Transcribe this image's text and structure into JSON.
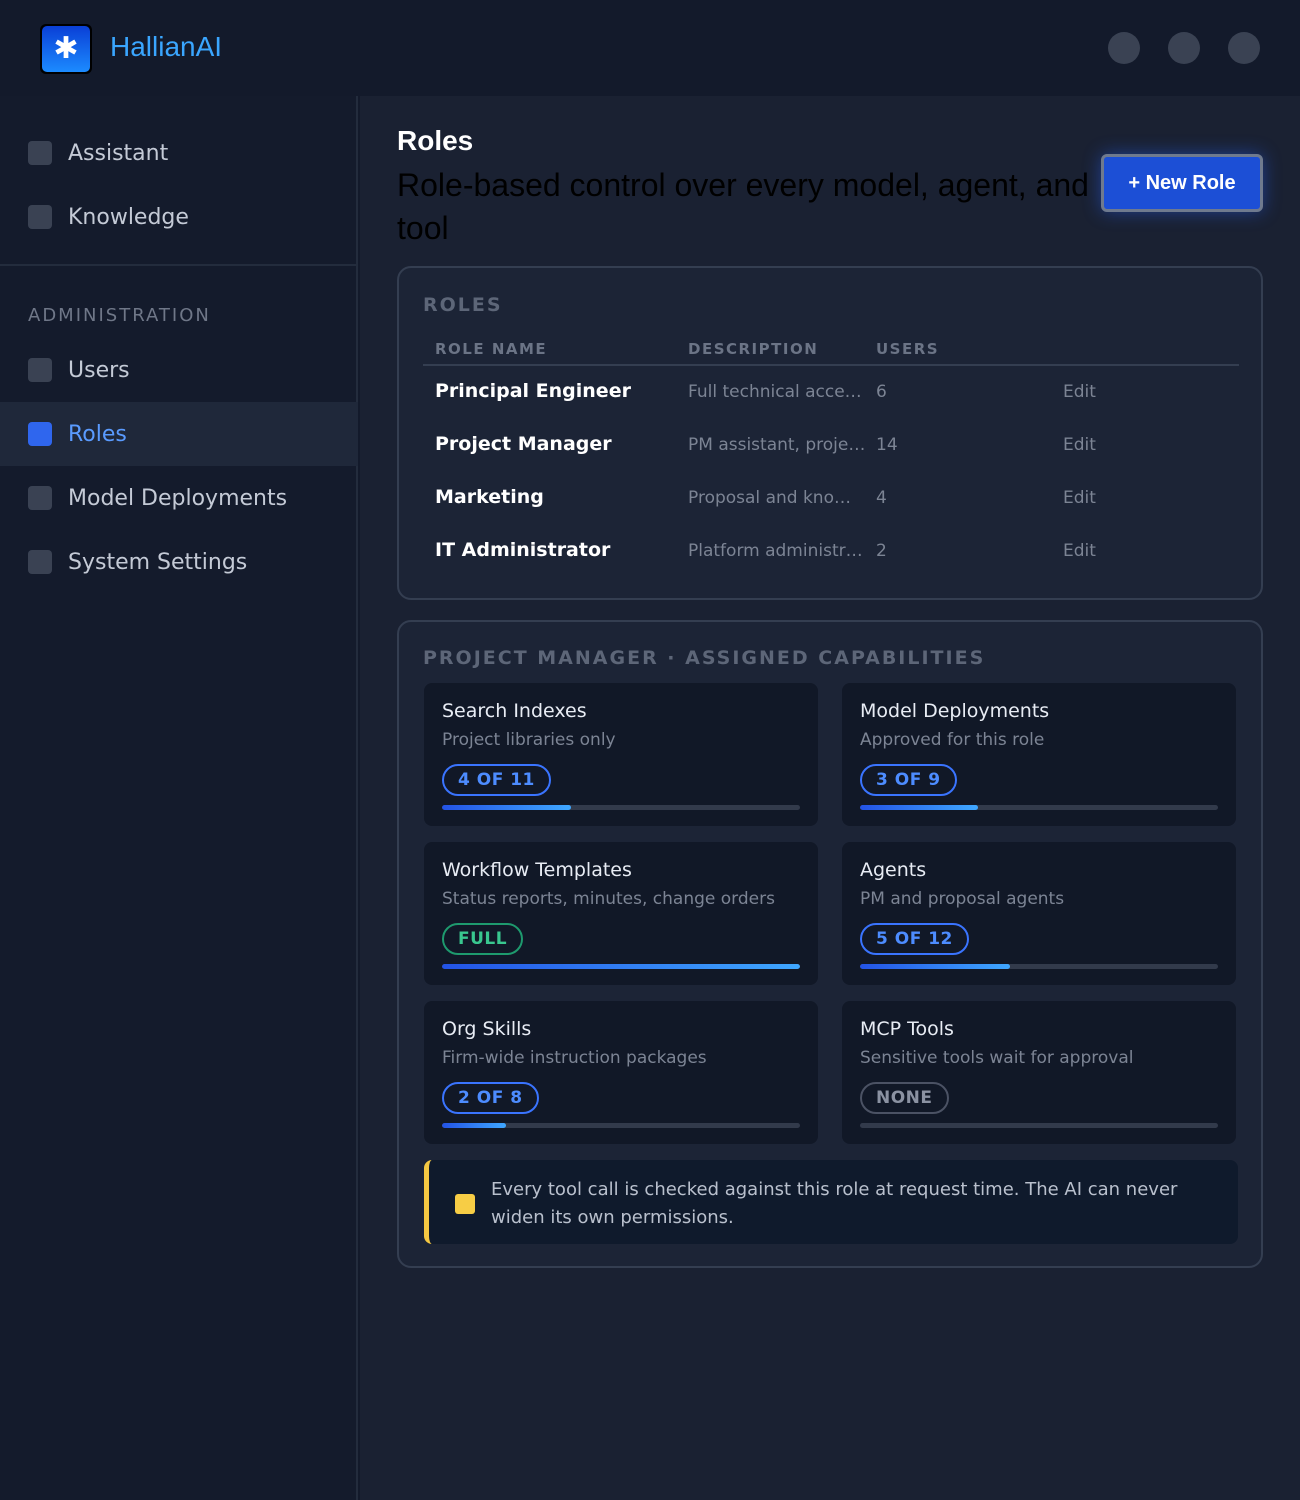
{
  "app": {
    "name": "HallianAI",
    "logo_glyph": "✱"
  },
  "sidebar": {
    "items": [
      {
        "label": "Assistant"
      },
      {
        "label": "Knowledge"
      }
    ],
    "admin_label": "ADMINISTRATION",
    "admin_items": [
      {
        "label": "Users",
        "active": false
      },
      {
        "label": "Roles",
        "active": true
      },
      {
        "label": "Model Deployments",
        "active": false
      },
      {
        "label": "System Settings",
        "active": false
      }
    ]
  },
  "page": {
    "title": "Roles",
    "subtitle": "Role-based control over every model, agent, and tool",
    "new_button": "+ New Role"
  },
  "roles_table": {
    "title": "ROLES",
    "headers": [
      "ROLE NAME",
      "DESCRIPTION",
      "USERS"
    ],
    "rows": [
      {
        "name": "Principal Engineer",
        "description": "Full technical acce…",
        "users": "6",
        "action": "Edit"
      },
      {
        "name": "Project Manager",
        "description": "PM assistant, proje…",
        "users": "14",
        "action": "Edit"
      },
      {
        "name": "Marketing",
        "description": "Proposal and kno…",
        "users": "4",
        "action": "Edit"
      },
      {
        "name": "IT Administrator",
        "description": "Platform administr…",
        "users": "2",
        "action": "Edit"
      }
    ]
  },
  "capabilities": {
    "title": "PROJECT MANAGER · ASSIGNED CAPABILITIES",
    "cards": [
      {
        "title": "Search Indexes",
        "subtitle": "Project libraries only",
        "badge": "4 OF 11",
        "kind": "partial",
        "fill": 0.36
      },
      {
        "title": "Model Deployments",
        "subtitle": "Approved for this role",
        "badge": "3 OF 9",
        "kind": "partial",
        "fill": 0.33
      },
      {
        "title": "Workflow Templates",
        "subtitle": "Status reports, minutes, change orders",
        "badge": "FULL",
        "kind": "full",
        "fill": 1.0
      },
      {
        "title": "Agents",
        "subtitle": "PM and proposal agents",
        "badge": "5 OF 12",
        "kind": "partial",
        "fill": 0.42
      },
      {
        "title": "Org Skills",
        "subtitle": "Firm-wide instruction packages",
        "badge": "2 OF 8",
        "kind": "partial",
        "fill": 0.18
      },
      {
        "title": "MCP Tools",
        "subtitle": "Sensitive tools wait for approval",
        "badge": "NONE",
        "kind": "none",
        "fill": 0
      }
    ],
    "notice": "Every tool call is checked against this role at request time. The AI can never widen its own permissions."
  }
}
